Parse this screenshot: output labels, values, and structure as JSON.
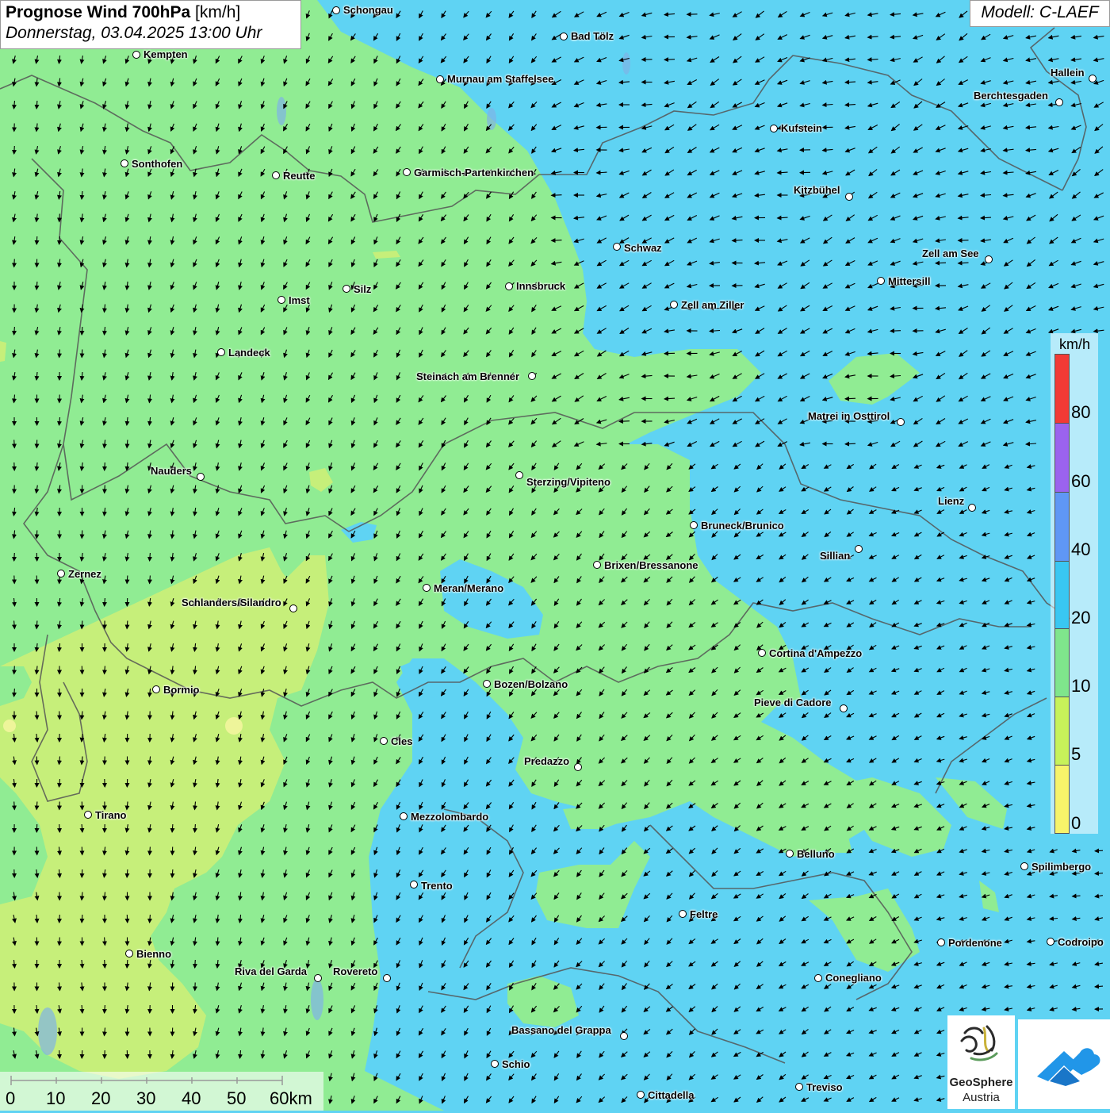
{
  "title": {
    "main": "Prognose Wind 700hPa",
    "unit": "[km/h]",
    "datetime": "Donnerstag, 03.04.2025 13:00 Uhr"
  },
  "model": "Modell: C-LAEF",
  "legend": {
    "unit": "km/h",
    "labels": [
      "80",
      "60",
      "40",
      "20",
      "10",
      "5",
      "0"
    ],
    "colors": {
      "80": "#f23a35",
      "60": "#9b63ee",
      "40": "#5f97f5",
      "20": "#39c7f2",
      "10": "#7fe58c",
      "5": "#c7f25a",
      "0": "#f7f36a"
    }
  },
  "scale_bar": {
    "labels": [
      "0",
      "10",
      "20",
      "30",
      "40",
      "50",
      "60km"
    ]
  },
  "logos": {
    "geosphere_line1": "GeoSphere",
    "geosphere_line2": "Austria"
  },
  "cities": [
    {
      "name": "Schongau"
    },
    {
      "name": "Bad Tölz"
    },
    {
      "name": "Kempten"
    },
    {
      "name": "Murnau am Staffelsee"
    },
    {
      "name": "Hallein"
    },
    {
      "name": "Berchtesgaden"
    },
    {
      "name": "Kufstein"
    },
    {
      "name": "Sonthofen"
    },
    {
      "name": "Reutte"
    },
    {
      "name": "Garmisch-Partenkirchen"
    },
    {
      "name": "Kitzbühel"
    },
    {
      "name": "Schwaz"
    },
    {
      "name": "Zell am See"
    },
    {
      "name": "Mittersill"
    },
    {
      "name": "Innsbruck"
    },
    {
      "name": "Silz"
    },
    {
      "name": "Imst"
    },
    {
      "name": "Zell am Ziller"
    },
    {
      "name": "Landeck"
    },
    {
      "name": "Steinach am Brenner"
    },
    {
      "name": "Matrei in Osttirol"
    },
    {
      "name": "Nauders"
    },
    {
      "name": "Sterzing/Vipiteno"
    },
    {
      "name": "Lienz"
    },
    {
      "name": "Bruneck/Brunico"
    },
    {
      "name": "Sillian"
    },
    {
      "name": "Zernez"
    },
    {
      "name": "Brixen/Bressanone"
    },
    {
      "name": "Meran/Merano"
    },
    {
      "name": "Schlanders/Silandro"
    },
    {
      "name": "Cortina d'Ampezzo"
    },
    {
      "name": "Bozen/Bolzano"
    },
    {
      "name": "Bormio"
    },
    {
      "name": "Pieve di Cadore"
    },
    {
      "name": "Cles"
    },
    {
      "name": "Predazzo"
    },
    {
      "name": "Tirano"
    },
    {
      "name": "Mezzolombardo"
    },
    {
      "name": "Belluno"
    },
    {
      "name": "Spilimbergo"
    },
    {
      "name": "Trento"
    },
    {
      "name": "Feltre"
    },
    {
      "name": "Pordenone"
    },
    {
      "name": "Codroipo"
    },
    {
      "name": "Bienno"
    },
    {
      "name": "Riva del Garda"
    },
    {
      "name": "Rovereto"
    },
    {
      "name": "Conegliano"
    },
    {
      "name": "Bassano del Grappa"
    },
    {
      "name": "Schio"
    },
    {
      "name": "Treviso"
    },
    {
      "name": "Cittadella"
    }
  ]
}
